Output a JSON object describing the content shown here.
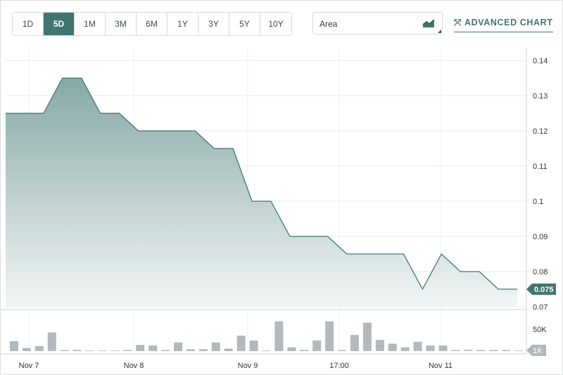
{
  "toolbar": {
    "ranges": [
      {
        "label": "1D",
        "active": false
      },
      {
        "label": "5D",
        "active": true
      },
      {
        "label": "1M",
        "active": false
      },
      {
        "label": "3M",
        "active": false
      },
      {
        "label": "6M",
        "active": false
      },
      {
        "label": "1Y",
        "active": false
      },
      {
        "label": "3Y",
        "active": false
      },
      {
        "label": "5Y",
        "active": false
      },
      {
        "label": "10Y",
        "active": false
      }
    ],
    "chart_type_value": "Area",
    "chart_type_icon": "area-chart-icon",
    "advanced_label": "ADVANCED CHART",
    "advanced_icon": "expand-arrows-icon"
  },
  "colors": {
    "accent": "#3f7672",
    "line": "#3f7672",
    "fill_top": "#86a9a6",
    "fill_bottom": "#f2f5f5",
    "volume": "#b3b8bc"
  },
  "chart_data": {
    "type": "area",
    "price_axis": {
      "ticks": [
        "0.14",
        "0.13",
        "0.12",
        "0.11",
        "0.1",
        "0.09",
        "0.08",
        "0.07"
      ],
      "ylim": [
        0.07,
        0.14
      ]
    },
    "x_labels": [
      "Nov 7",
      "Nov 8",
      "Nov 9",
      "17:00",
      "Nov 11"
    ],
    "last_price_label": "0.075",
    "price": [
      0.125,
      0.125,
      0.125,
      0.135,
      0.135,
      0.125,
      0.125,
      0.12,
      0.12,
      0.12,
      0.12,
      0.115,
      0.115,
      0.1,
      0.1,
      0.09,
      0.09,
      0.09,
      0.085,
      0.085,
      0.085,
      0.085,
      0.075,
      0.085,
      0.08,
      0.08,
      0.075,
      0.075
    ],
    "volume_axis": {
      "ticks": [
        "50K",
        "1K"
      ]
    },
    "volume": [
      16,
      5,
      8,
      30,
      1,
      2,
      0,
      0,
      0,
      1,
      10,
      9,
      1,
      14,
      3,
      3,
      14,
      4,
      25,
      17,
      0,
      48,
      6,
      2,
      17,
      48,
      1,
      26,
      46,
      18,
      12,
      6,
      15,
      9,
      9,
      1,
      2,
      1,
      1,
      1,
      0
    ]
  }
}
